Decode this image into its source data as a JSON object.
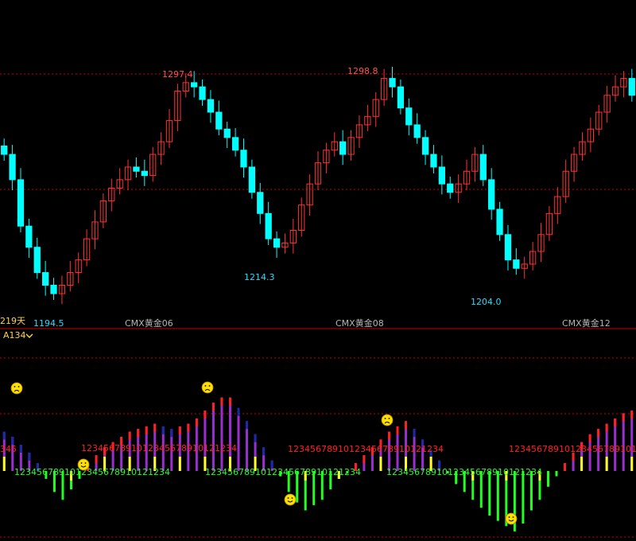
{
  "chart_data": {
    "type": "candlestick",
    "price_panel": {
      "annotations": {
        "high1": "1297.4",
        "high2": "1298.8",
        "low1": "1194.5",
        "low2": "1214.3",
        "low3": "1204.0"
      },
      "period_label": "219天",
      "contract_labels": [
        "CMX黄金06",
        "CMX黄金08",
        "CMX黄金12"
      ],
      "closes": [
        1262,
        1250,
        1228,
        1218,
        1206,
        1200,
        1196,
        1200,
        1206,
        1212,
        1222,
        1230,
        1240,
        1246,
        1250,
        1256,
        1254,
        1252,
        1262,
        1268,
        1278,
        1292,
        1296,
        1294,
        1288,
        1282,
        1274,
        1270,
        1264,
        1256,
        1244,
        1234,
        1222,
        1218,
        1220,
        1226,
        1238,
        1248,
        1258,
        1264,
        1268,
        1262,
        1270,
        1276,
        1280,
        1288,
        1298,
        1294,
        1284,
        1276,
        1270,
        1262,
        1256,
        1248,
        1244,
        1248,
        1254,
        1262,
        1250,
        1236,
        1224,
        1212,
        1208,
        1210,
        1216,
        1224,
        1234,
        1242,
        1254,
        1262,
        1268,
        1274,
        1282,
        1290,
        1294,
        1298,
        1290
      ],
      "colors": {
        "up": "#ff3232",
        "down": "#00ffff",
        "dash": "#c80000"
      }
    },
    "indicator_panel": {
      "label": "A134",
      "bar_strip_text": "1234567891012345678910121234",
      "values": [
        30,
        26,
        20,
        14,
        6,
        -6,
        -16,
        -22,
        -14,
        -6,
        4,
        12,
        18,
        22,
        26,
        30,
        32,
        34,
        36,
        34,
        32,
        34,
        36,
        40,
        46,
        52,
        56,
        56,
        48,
        38,
        28,
        18,
        8,
        -4,
        -16,
        -24,
        -30,
        -26,
        -22,
        -14,
        -6,
        -2,
        6,
        12,
        18,
        24,
        30,
        34,
        38,
        32,
        24,
        16,
        8,
        -2,
        -10,
        -16,
        -22,
        -28,
        -34,
        -38,
        -42,
        -46,
        -40,
        -30,
        -22,
        -12,
        -4,
        6,
        14,
        22,
        28,
        32,
        36,
        40,
        44,
        46
      ],
      "colors": {
        "positive": "#ff2020",
        "negative": "#22ff22",
        "purple": "#9a2fd0",
        "yellow": "#ffff22",
        "blue": "#1a2aa8"
      }
    }
  }
}
